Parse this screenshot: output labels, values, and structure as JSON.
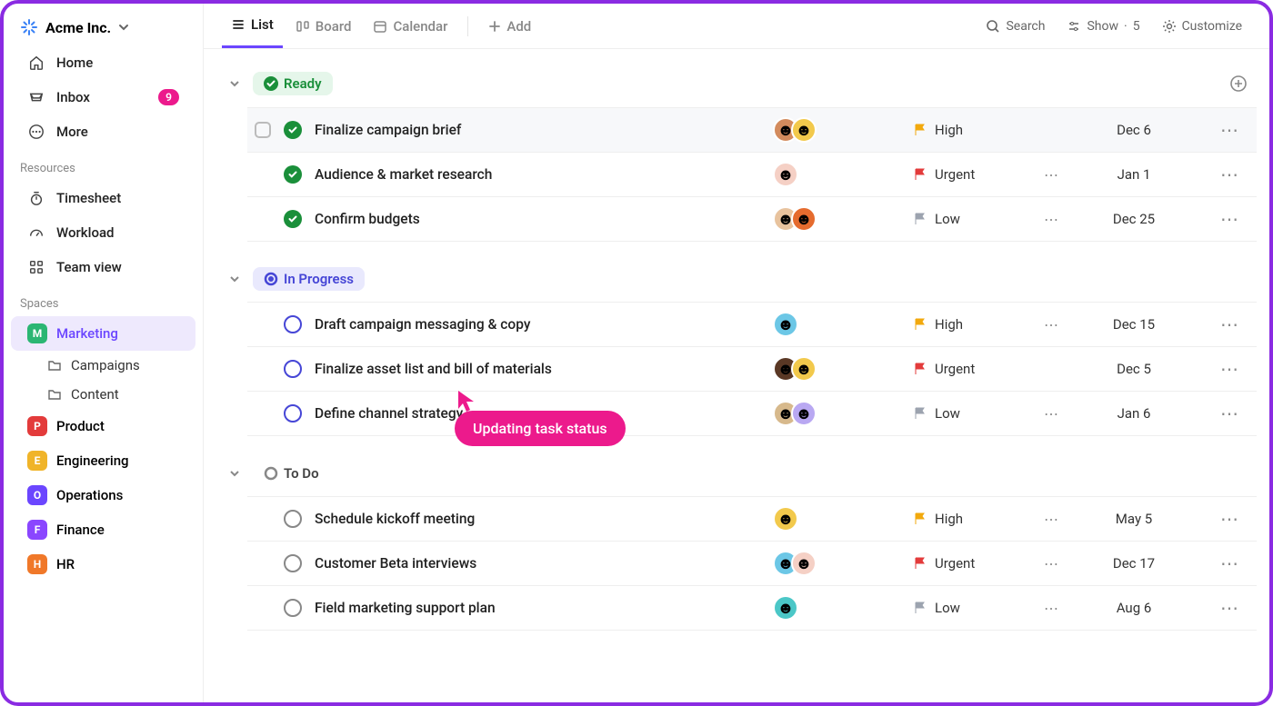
{
  "workspace": {
    "name": "Acme Inc."
  },
  "nav": {
    "home": "Home",
    "inbox": "Inbox",
    "inbox_badge": "9",
    "more": "More"
  },
  "resources": {
    "label": "Resources",
    "timesheet": "Timesheet",
    "workload": "Workload",
    "teamview": "Team view"
  },
  "spaces": {
    "label": "Spaces",
    "items": [
      {
        "letter": "M",
        "name": "Marketing",
        "color": "#2bb673",
        "active": true,
        "children": [
          "Campaigns",
          "Content"
        ]
      },
      {
        "letter": "P",
        "name": "Product",
        "color": "#e33b3b"
      },
      {
        "letter": "E",
        "name": "Engineering",
        "color": "#f0b429"
      },
      {
        "letter": "O",
        "name": "Operations",
        "color": "#6b46ff"
      },
      {
        "letter": "F",
        "name": "Finance",
        "color": "#8a46ff"
      },
      {
        "letter": "H",
        "name": "HR",
        "color": "#f07829"
      }
    ]
  },
  "views": {
    "list": "List",
    "board": "Board",
    "calendar": "Calendar",
    "add": "Add"
  },
  "tools": {
    "search": "Search",
    "show": "Show",
    "show_count": "5",
    "customize": "Customize"
  },
  "groups": [
    {
      "status": "Ready",
      "pill_class": "pill-ready",
      "circle": "done",
      "show_add": true,
      "tasks": [
        {
          "name": "Finalize campaign brief",
          "avatars": [
            "#d38b5d",
            "#f2c94c"
          ],
          "prio": "High",
          "prio_color": "#f2a90d",
          "sub": "",
          "due": "Dec 6",
          "selected": true
        },
        {
          "name": "Audience & market research",
          "avatars": [
            "#f5d0c5"
          ],
          "prio": "Urgent",
          "prio_color": "#e33b3b",
          "sub": "⋯",
          "due": "Jan 1"
        },
        {
          "name": "Confirm budgets",
          "avatars": [
            "#e8c39e",
            "#e56b2e"
          ],
          "prio": "Low",
          "prio_color": "#9ca3af",
          "sub": "⋯",
          "due": "Dec 25"
        }
      ]
    },
    {
      "status": "In Progress",
      "pill_class": "pill-progress",
      "circle": "prog",
      "tasks": [
        {
          "name": "Draft campaign messaging & copy",
          "avatars": [
            "#6cc7e6"
          ],
          "prio": "High",
          "prio_color": "#f2a90d",
          "sub": "⋯",
          "due": "Dec 15"
        },
        {
          "name": "Finalize asset list and bill of materials",
          "avatars": [
            "#5a3825",
            "#f2c94c"
          ],
          "prio": "Urgent",
          "prio_color": "#e33b3b",
          "sub": "",
          "due": "Dec 5"
        },
        {
          "name": "Define channel strategy",
          "avatars": [
            "#d7b98c",
            "#b9a8f2"
          ],
          "prio": "Low",
          "prio_color": "#9ca3af",
          "sub": "⋯",
          "due": "Jan 6"
        }
      ]
    },
    {
      "status": "To Do",
      "pill_class": "pill-todo",
      "circle": "todo",
      "tasks": [
        {
          "name": "Schedule kickoff meeting",
          "avatars": [
            "#f2c94c"
          ],
          "prio": "High",
          "prio_color": "#f2a90d",
          "sub": "⋯",
          "due": "May 5"
        },
        {
          "name": "Customer Beta interviews",
          "avatars": [
            "#6cc7e6",
            "#f5d0c5"
          ],
          "prio": "Urgent",
          "prio_color": "#e33b3b",
          "sub": "⋯",
          "due": "Dec 17"
        },
        {
          "name": "Field marketing support plan",
          "avatars": [
            "#4bc7c7"
          ],
          "prio": "Low",
          "prio_color": "#9ca3af",
          "sub": "⋯",
          "due": "Aug 6"
        }
      ]
    }
  ],
  "tooltip": {
    "text": "Updating task status"
  }
}
